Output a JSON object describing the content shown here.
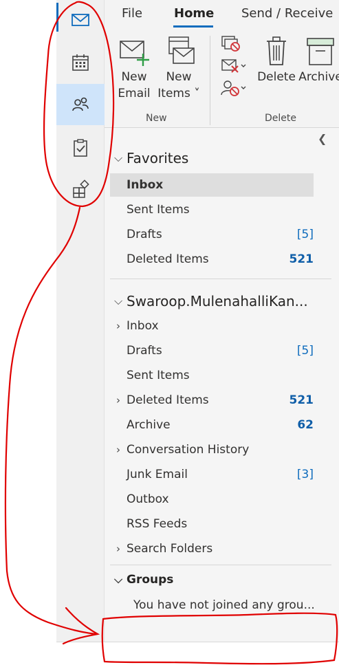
{
  "ribbon": {
    "tabs": [
      "File",
      "Home",
      "Send / Receive"
    ],
    "active_tab": "Home",
    "new_group": {
      "label": "New",
      "new_email_line1": "New",
      "new_email_line2": "Email",
      "new_items_line1": "New",
      "new_items_line2": "Items ˅"
    },
    "delete_group": {
      "label": "Delete",
      "delete": "Delete",
      "archive": "Archive"
    }
  },
  "rail": {
    "items": [
      "mail-icon",
      "calendar-icon",
      "people-icon",
      "tasks-icon",
      "apps-icon"
    ],
    "selected": "people-icon"
  },
  "favorites": {
    "header": "Favorites",
    "items": [
      {
        "name": "Inbox",
        "count": "",
        "selected": true
      },
      {
        "name": "Sent Items",
        "count": ""
      },
      {
        "name": "Drafts",
        "count": "[5]"
      },
      {
        "name": "Deleted Items",
        "count": "521"
      }
    ]
  },
  "account": {
    "header": "Swaroop.MulenahalliKan...",
    "items": [
      {
        "name": "Inbox",
        "count": "",
        "expandable": true
      },
      {
        "name": "Drafts",
        "count": "[5]"
      },
      {
        "name": "Sent Items",
        "count": ""
      },
      {
        "name": "Deleted Items",
        "count": "521",
        "expandable": true
      },
      {
        "name": "Archive",
        "count": "62"
      },
      {
        "name": "Conversation History",
        "count": "",
        "expandable": true
      },
      {
        "name": "Junk Email",
        "count": "[3]"
      },
      {
        "name": "Outbox",
        "count": ""
      },
      {
        "name": "RSS Feeds",
        "count": ""
      },
      {
        "name": "Search Folders",
        "count": "",
        "expandable": true
      }
    ]
  },
  "groups": {
    "header": "Groups",
    "empty_text": "You have not joined any grou..."
  },
  "colors": {
    "accent": "#0f6cbd",
    "annotation": "#e00000",
    "unread": "#0f5ea8"
  }
}
